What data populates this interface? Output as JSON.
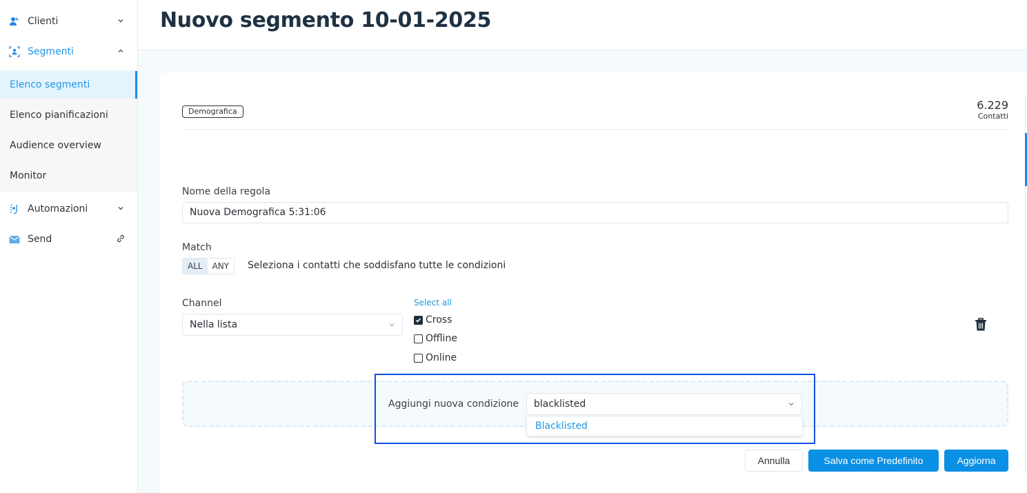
{
  "sidebar": {
    "groups": [
      {
        "label": "Clienti",
        "icon": "users-icon",
        "expanded": false
      },
      {
        "label": "Segmenti",
        "icon": "segment-icon",
        "expanded": true
      },
      {
        "label": "Automazioni",
        "icon": "automation-icon",
        "expanded": false
      },
      {
        "label": "Send",
        "icon": "mail-icon",
        "trailing_icon": "external-link-icon"
      }
    ],
    "sub_items": [
      {
        "label": "Elenco segmenti",
        "active": true
      },
      {
        "label": "Elenco pianificazioni",
        "active": false
      },
      {
        "label": "Audience overview",
        "active": false
      },
      {
        "label": "Monitor",
        "active": false
      }
    ]
  },
  "header": {
    "title": "Nuovo segmento 10-01-2025"
  },
  "rule": {
    "type_tag": "Demografica",
    "contacts_count": "6.229",
    "contacts_label": "Contatti",
    "name_label": "Nome della regola",
    "name_value": "Nuova Demografica 5:31:06",
    "match_label": "Match",
    "match_options": [
      "ALL",
      "ANY"
    ],
    "match_selected": "ALL",
    "match_description": "Seleziona i contatti che soddisfano tutte le condizioni"
  },
  "condition": {
    "field_label": "Channel",
    "operator_value": "Nella lista",
    "select_all_label": "Select all",
    "options": [
      {
        "label": "Cross",
        "checked": true
      },
      {
        "label": "Offline",
        "checked": false
      },
      {
        "label": "Online",
        "checked": false
      }
    ]
  },
  "add_condition": {
    "label": "Aggiungi nuova condizione",
    "search_value": "blacklisted",
    "suggestions": [
      "Blacklisted"
    ]
  },
  "actions": {
    "cancel": "Annulla",
    "save_default": "Salva come Predefinito",
    "update": "Aggiorna"
  },
  "colors": {
    "accent": "#2196e3",
    "primary_button": "#0a90e4",
    "title": "#1f3244",
    "highlight": "#0b4fe0"
  }
}
